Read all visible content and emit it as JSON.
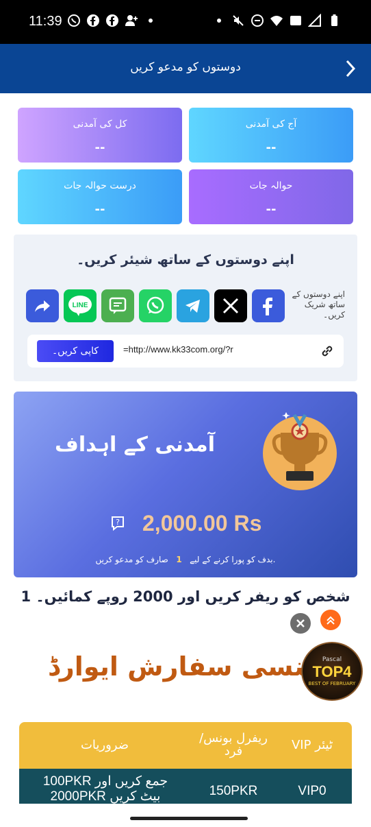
{
  "status_bar": {
    "time": "11:39"
  },
  "header": {
    "title": "دوستوں کو مدعو کریں"
  },
  "stats": {
    "total_income": {
      "label": "کل کی آمدنی",
      "value": "--"
    },
    "today_income": {
      "label": "آج کی آمدنی",
      "value": "--"
    },
    "valid_referrals": {
      "label": "درست حوالہ جات",
      "value": "--"
    },
    "referrals": {
      "label": "حوالہ جات",
      "value": "--"
    }
  },
  "share": {
    "title": "اپنے دوستوں کے ساتھ شیئر کریں۔",
    "hint": "اپنے دوستوں کے ساتھ شریک کریں۔",
    "apps": [
      "share-icon",
      "line-icon",
      "sms-icon",
      "whatsapp-icon",
      "telegram-icon",
      "x-icon",
      "facebook-icon"
    ],
    "line_label": "LINE",
    "copy_label": "کاپی کریں۔",
    "link": "=http://www.kk33com.org/?r"
  },
  "goal": {
    "title": "آمدنی کے اہداف",
    "amount": "2,000.00 Rs",
    "note_prefix": "بدف کو پورا کرنے کے لیے",
    "note_count": "1",
    "note_suffix": "صارف کو مدعو کریں."
  },
  "refer_line": "1 شخص کو ریفر کریں اور 2000 روپے کمائیں۔",
  "award": {
    "title": "جنسی سفارش ایوارڈ",
    "badge_line1": "Pascal",
    "badge_line2": "TOP4",
    "badge_line3": "BEST OF FEBRUARY"
  },
  "table": {
    "headers": [
      "VIP ٹیئر",
      "ریفرل بونس/ فرد",
      "ضروریات"
    ],
    "rows": [
      [
        "VIP0",
        "150PKR",
        "100PKR جمع کریں اور 2000PKR بیٹ کریں"
      ]
    ]
  },
  "colors": {
    "header_bg": "#0a4594",
    "award_text": "#c05a12",
    "table_head": "#f1bd3c",
    "table_row": "#154e5c"
  }
}
